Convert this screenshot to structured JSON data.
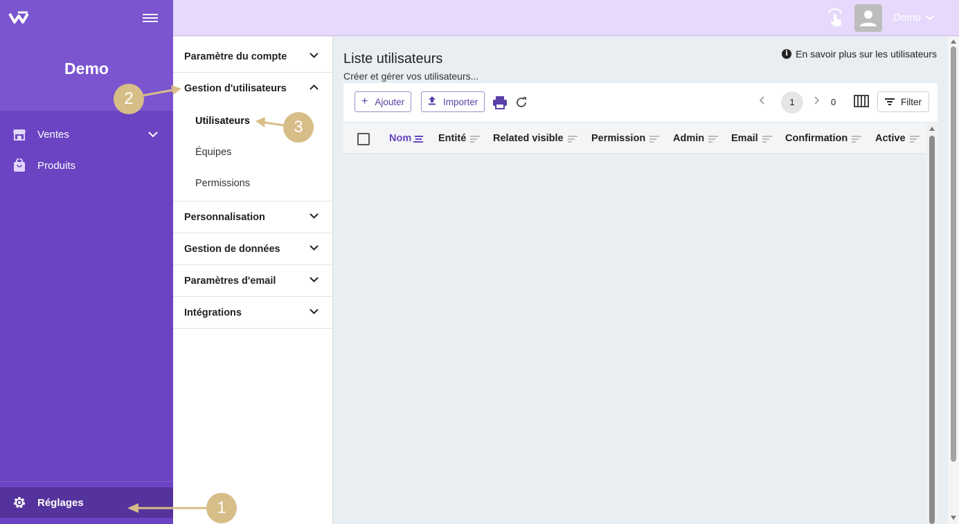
{
  "sidebar": {
    "org_name": "Demo",
    "items": [
      {
        "label": "Ventes",
        "icon": "store-icon",
        "has_submenu": true
      },
      {
        "label": "Produits",
        "icon": "shopping-bag-icon",
        "has_submenu": false
      }
    ],
    "settings_label": "Réglages",
    "settings_icon": "gear-icon"
  },
  "topbar": {
    "user_name": "Demo",
    "touch_icon": "touch-gesture-icon",
    "avatar_icon": "person-icon"
  },
  "settings_menu": {
    "sections": [
      {
        "label": "Paramètre du compte",
        "expanded": false
      },
      {
        "label": "Gestion d'utilisateurs",
        "expanded": true
      },
      {
        "label": "Personnalisation",
        "expanded": false
      },
      {
        "label": "Gestion de données",
        "expanded": false
      },
      {
        "label": "Paramètres d'email",
        "expanded": false
      },
      {
        "label": "Intégrations",
        "expanded": false
      }
    ],
    "user_mgmt_items": [
      "Utilisateurs",
      "Équipes",
      "Permissions"
    ],
    "active_item": "Utilisateurs"
  },
  "main": {
    "title": "Liste utilisateurs",
    "subtitle": "Créer et gérer vos utilisateurs...",
    "learn_more": "En savoir plus sur les utilisateurs",
    "toolbar": {
      "add_label": "Ajouter",
      "import_label": "Importer",
      "print_icon": "print-icon",
      "refresh_icon": "refresh-icon",
      "current_page": "1",
      "total": "0",
      "columns_icon": "columns-icon",
      "filter_label": "Filter"
    },
    "table": {
      "columns": [
        "Nom",
        "Entité",
        "Related visible",
        "Permission",
        "Admin",
        "Email",
        "Confirmation",
        "Active"
      ],
      "sorted_column": "Nom",
      "rows": []
    }
  },
  "annotations": [
    "1",
    "2",
    "3"
  ],
  "colors": {
    "sidebar": "#6a44c2",
    "sidebar_header": "#7b55cf",
    "topbar": "#e6d9fb",
    "accent": "#6a44c2",
    "annotation": "#d7bd87"
  }
}
